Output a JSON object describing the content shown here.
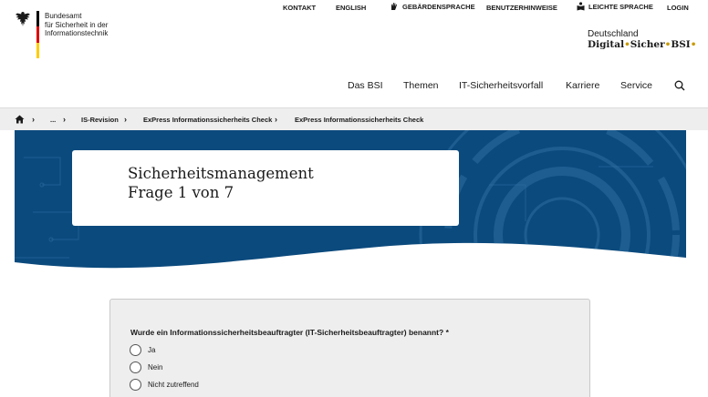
{
  "topbar": {
    "kontakt": "KONTAKT",
    "english": "ENGLISH",
    "gebaerdensprache": "GEBÄRDENSPRACHE",
    "benutzerhinweise": "BENUTZERHINWEISE",
    "leichte_sprache": "LEICHTE SPRACHE",
    "login": "LOGIN"
  },
  "logo": {
    "line1": "Bundesamt",
    "line2": "für Sicherheit in der",
    "line3": "Informationstechnik"
  },
  "brand": {
    "line1": "Deutschland",
    "word1": "Digital",
    "sep1": "•",
    "word2": "Sicher",
    "sep2": "•",
    "word3": "BSI",
    "sep3": "•"
  },
  "nav": {
    "items": [
      "Das BSI",
      "Themen",
      "IT-Sicherheitsvorfall",
      "Karriere",
      "Service"
    ]
  },
  "breadcrumb": {
    "ellipsis": "...",
    "item1": "IS-Revision",
    "item2": "ExPress Informationssicherheits Check",
    "item3": "ExPress Informationssicherheits Check"
  },
  "hero": {
    "title": "Sicherheitsmanagement",
    "subtitle": "Frage 1 von 7"
  },
  "form": {
    "question": "Wurde ein Informationssicherheitsbeauftragter (IT-Sicherheitsbeauftragter) benannt? *",
    "options": [
      "Ja",
      "Nein",
      "Nicht zutreffend"
    ]
  },
  "colors": {
    "hero_blue": "#0b4a7d",
    "hero_blue_light": "#2e6da0",
    "flag_black": "#000000",
    "flag_red": "#dd0000",
    "flag_gold": "#ffcc00",
    "accent_dot": "#c89b00"
  }
}
